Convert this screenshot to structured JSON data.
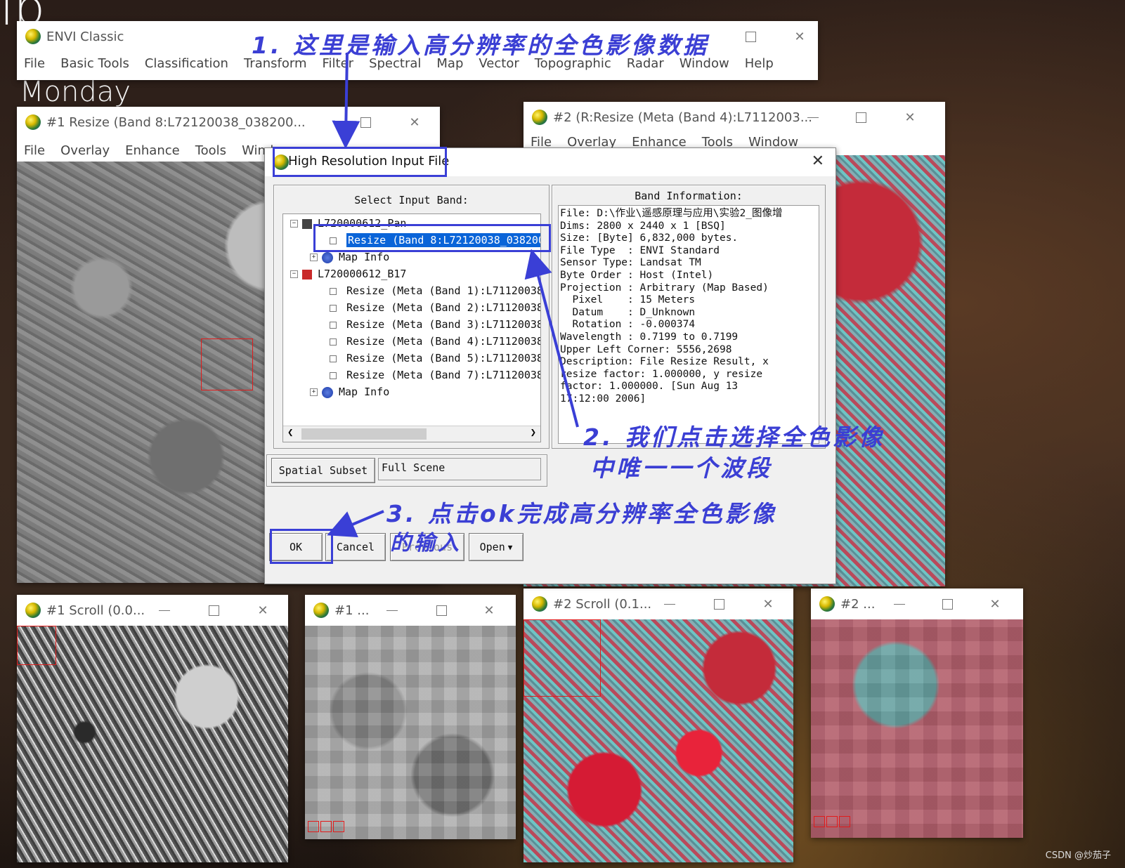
{
  "desktop": {
    "corner_text": "lb",
    "day": "Monday",
    "watermark": "CSDN @炒茄子"
  },
  "main_window": {
    "title": "ENVI Classic",
    "menu": [
      "File",
      "Basic Tools",
      "Classification",
      "Transform",
      "Filter",
      "Spectral",
      "Map",
      "Vector",
      "Topographic",
      "Radar",
      "Window",
      "Help"
    ]
  },
  "image1_window": {
    "title": "#1 Resize (Band 8:L72120038_038200...",
    "menu": [
      "File",
      "Overlay",
      "Enhance",
      "Tools",
      "Wind"
    ]
  },
  "image2_window": {
    "title": "#2 (R:Resize (Meta (Band 4):L7112003...",
    "menu": [
      "File",
      "Overlay",
      "Enhance",
      "Tools",
      "Window"
    ]
  },
  "scroll1_window": {
    "title": "#1 Scroll (0.0..."
  },
  "zoom1_window": {
    "title": "#1 ..."
  },
  "scroll2_window": {
    "title": "#2 Scroll (0.1..."
  },
  "zoom2_window": {
    "title": "#2 ..."
  },
  "dialog": {
    "title": "High Resolution Input File",
    "select_label": "Select Input Band:",
    "tree": {
      "file1": "L720000612_Pan",
      "file1_band": "Resize (Band 8:L72120038_038200",
      "file1_map": "Map Info",
      "file2": "L720000612_B17",
      "file2_bands": [
        "Resize (Meta (Band 1):L71120038",
        "Resize (Meta (Band 2):L71120038",
        "Resize (Meta (Band 3):L71120038",
        "Resize (Meta (Band 4):L71120038",
        "Resize (Meta (Band 5):L71120038",
        "Resize (Meta (Band 7):L71120038"
      ],
      "file2_map": "Map Info"
    },
    "band_info_label": "Band Information:",
    "band_info": [
      "File: D:\\作业\\遥感原理与应用\\实验2_图像增",
      "Dims: 2800 x 2440 x 1 [BSQ]",
      "Size: [Byte] 6,832,000 bytes.",
      "File Type  : ENVI Standard",
      "Sensor Type: Landsat TM",
      "Byte Order : Host (Intel)",
      "Projection : Arbitrary (Map Based)",
      "  Pixel    : 15 Meters",
      "  Datum    : D_Unknown",
      "  Rotation : -0.000374",
      "Wavelength : 0.7199 to 0.7199",
      "Upper Left Corner: 5556,2698",
      "Description: File Resize Result, x",
      "resize factor: 1.000000, y resize",
      "factor: 1.000000. [Sun Aug 13",
      "17:12:00 2006]"
    ],
    "spatial_subset_button": "Spatial Subset",
    "spatial_subset_value": "Full Scene",
    "buttons": {
      "ok": "OK",
      "cancel": "Cancel",
      "previous": "Previous",
      "open": "Open"
    }
  },
  "annotations": {
    "step1": "1. 这里是输入高分辨率的全色影像数据",
    "step2_line1": "2. 我们点击选择全色影像",
    "step2_line2": "中唯一一个波段",
    "step3_line1": "3. 点击ok完成高分辨率全色影像",
    "step3_line2": "的输入"
  },
  "colors": {
    "annotation_blue": "#3a3fd6",
    "selection_blue": "#0a64d8",
    "red_box": "#e21b1b"
  }
}
